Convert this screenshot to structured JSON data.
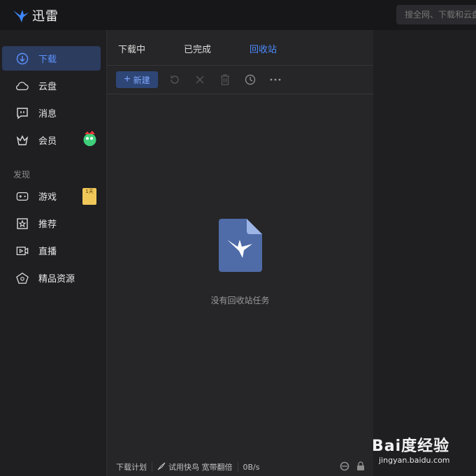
{
  "app": {
    "title": "迅雷"
  },
  "search": {
    "placeholder": "搜全网、下载和云盘"
  },
  "sidebar": {
    "items": [
      {
        "label": "下载",
        "icon": "download-icon",
        "active": true
      },
      {
        "label": "云盘",
        "icon": "cloud-icon"
      },
      {
        "label": "消息",
        "icon": "message-icon"
      },
      {
        "label": "会员",
        "icon": "crown-icon"
      }
    ],
    "section": "发现",
    "discover": [
      {
        "label": "游戏",
        "icon": "gamepad-icon"
      },
      {
        "label": "推荐",
        "icon": "star-icon"
      },
      {
        "label": "直播",
        "icon": "video-icon"
      },
      {
        "label": "精品资源",
        "icon": "gem-icon"
      }
    ],
    "game_badge": "1天"
  },
  "tabs": [
    {
      "label": "下载中"
    },
    {
      "label": "已完成"
    },
    {
      "label": "回收站",
      "active": true
    }
  ],
  "toolbar": {
    "new_label": "新建"
  },
  "empty": {
    "message": "没有回收站任务"
  },
  "status": {
    "plan": "下载计划",
    "trial": "试用快鸟 宽带翻倍",
    "speed": "0B/s"
  },
  "watermark": {
    "brand": "Bai度经验",
    "url": "jingyan.baidu.com"
  },
  "colors": {
    "accent": "#4d8bff",
    "active_bg": "#2c3c5f"
  }
}
